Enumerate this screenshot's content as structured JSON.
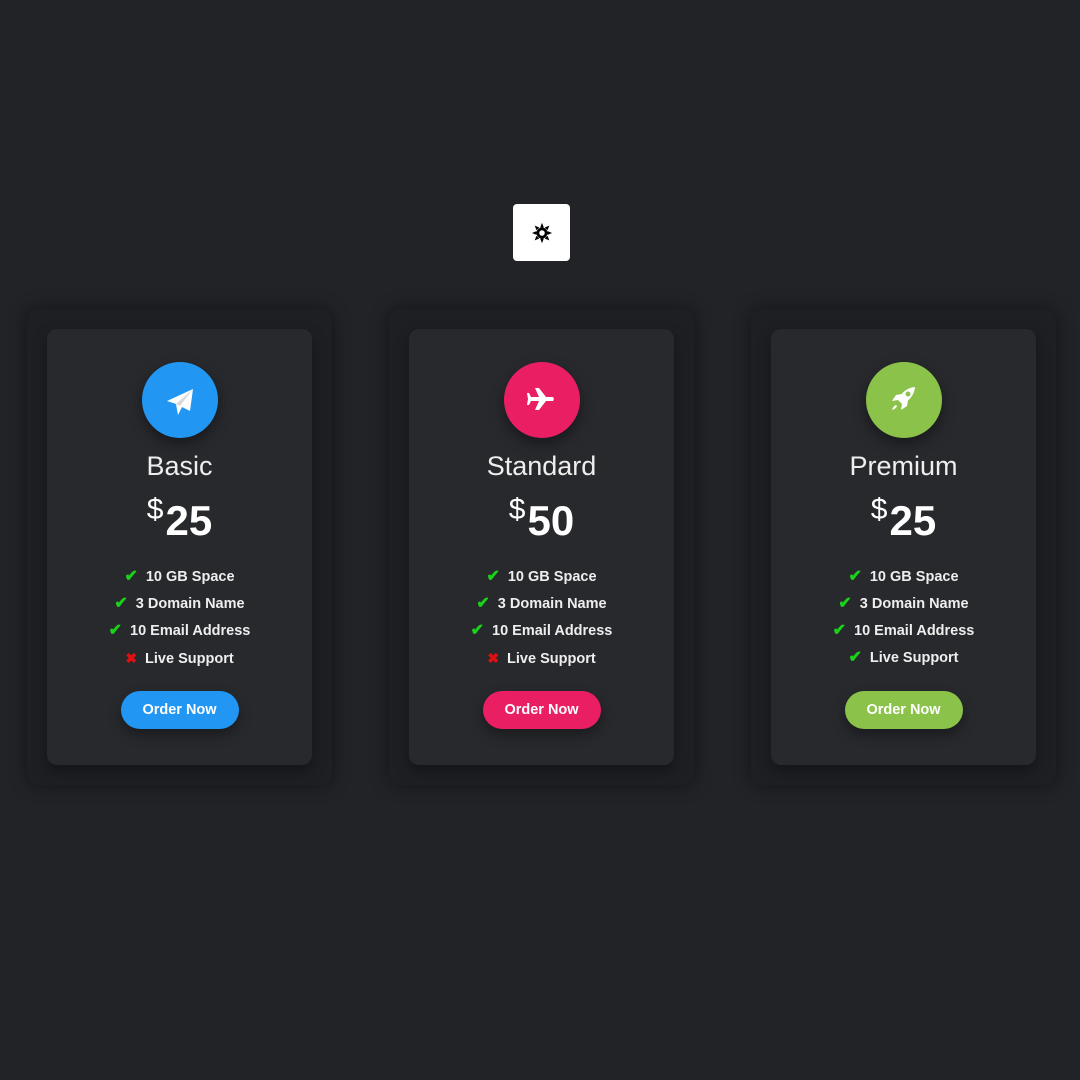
{
  "theme_toggle": {
    "icon": "sun-icon"
  },
  "plans": [
    {
      "name": "Basic",
      "currency": "$",
      "price": "25",
      "color": "#2196f3",
      "icon": "paper-plane-icon",
      "features": [
        {
          "text": "10 GB Space",
          "included": true
        },
        {
          "text": "3 Domain Name",
          "included": true
        },
        {
          "text": "10 Email Address",
          "included": true
        },
        {
          "text": "Live Support",
          "included": false
        }
      ],
      "button": "Order Now"
    },
    {
      "name": "Standard",
      "currency": "$",
      "price": "50",
      "color": "#e91e63",
      "icon": "plane-icon",
      "features": [
        {
          "text": "10 GB Space",
          "included": true
        },
        {
          "text": "3 Domain Name",
          "included": true
        },
        {
          "text": "10 Email Address",
          "included": true
        },
        {
          "text": "Live Support",
          "included": false
        }
      ],
      "button": "Order Now"
    },
    {
      "name": "Premium",
      "currency": "$",
      "price": "25",
      "color": "#8bc34a",
      "icon": "rocket-icon",
      "features": [
        {
          "text": "10 GB Space",
          "included": true
        },
        {
          "text": "3 Domain Name",
          "included": true
        },
        {
          "text": "10 Email Address",
          "included": true
        },
        {
          "text": "Live Support",
          "included": true
        }
      ],
      "button": "Order Now"
    }
  ]
}
